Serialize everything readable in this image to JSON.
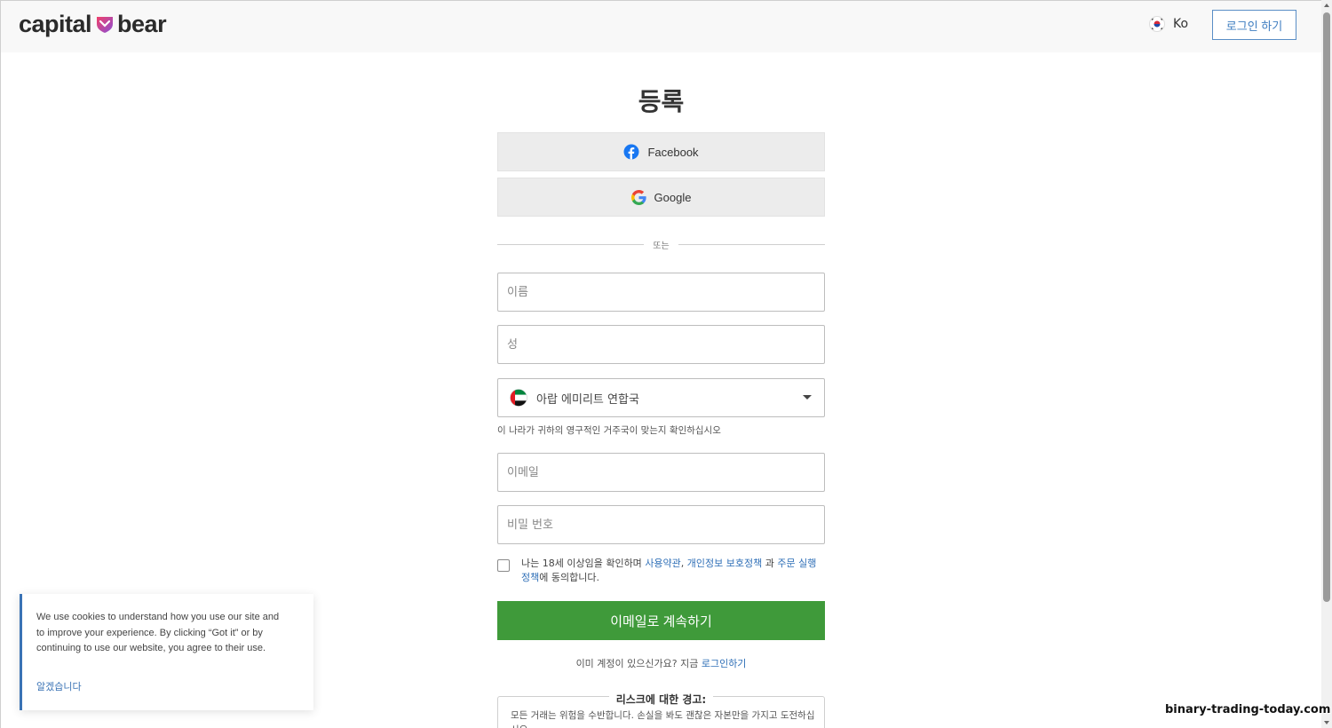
{
  "header": {
    "logo_left": "capital",
    "logo_right": "bear",
    "language_flag_icon": "south-korea-flag-icon",
    "language": "Ko",
    "login_button": "로그인 하기"
  },
  "form": {
    "title": "등록",
    "facebook_label": "Facebook",
    "google_label": "Google",
    "divider_text": "또는",
    "first_name_placeholder": "이름",
    "last_name_placeholder": "성",
    "country": {
      "flag_icon": "uae-flag-icon",
      "selected": "아랍 에미리트 연합국"
    },
    "country_hint": "이 나라가 귀하의 영구적인 거주국이 맞는지 확인하십시오",
    "email_placeholder": "이메일",
    "password_placeholder": "비밀 번호",
    "consent": {
      "prefix": "나는 18세 이상임을 확인하며 ",
      "terms_link": "사용약관",
      "comma": ", ",
      "privacy_link": "개인정보 보호정책",
      "and": " 과 ",
      "execution_link": "주문 실행 정책",
      "suffix": "에 동의합니다."
    },
    "continue_button": "이메일로 계속하기",
    "have_account_text": "이미 계정이 있으신가요? 지금 ",
    "have_account_link": "로그인하기",
    "risk_title": "리스크에 대한 경고:",
    "risk_text": "모든 거래는 위험을 수반합니다. 손실을 봐도 괜찮은 자본만을 가지고 도전하십시오."
  },
  "cookie_banner": {
    "text": "We use cookies to understand how you use our site and to improve your experience. By clicking “Got it” or by continuing to use our website, you agree to their use.",
    "ok_button": "알겠습니다"
  },
  "watermark": "binary-trading-today.com",
  "colors": {
    "accent_blue": "#3a73b5",
    "continue_green": "#3f9a3a",
    "logo_heart": "#e8336b",
    "logo_heart_secondary": "#8a4fd6"
  }
}
